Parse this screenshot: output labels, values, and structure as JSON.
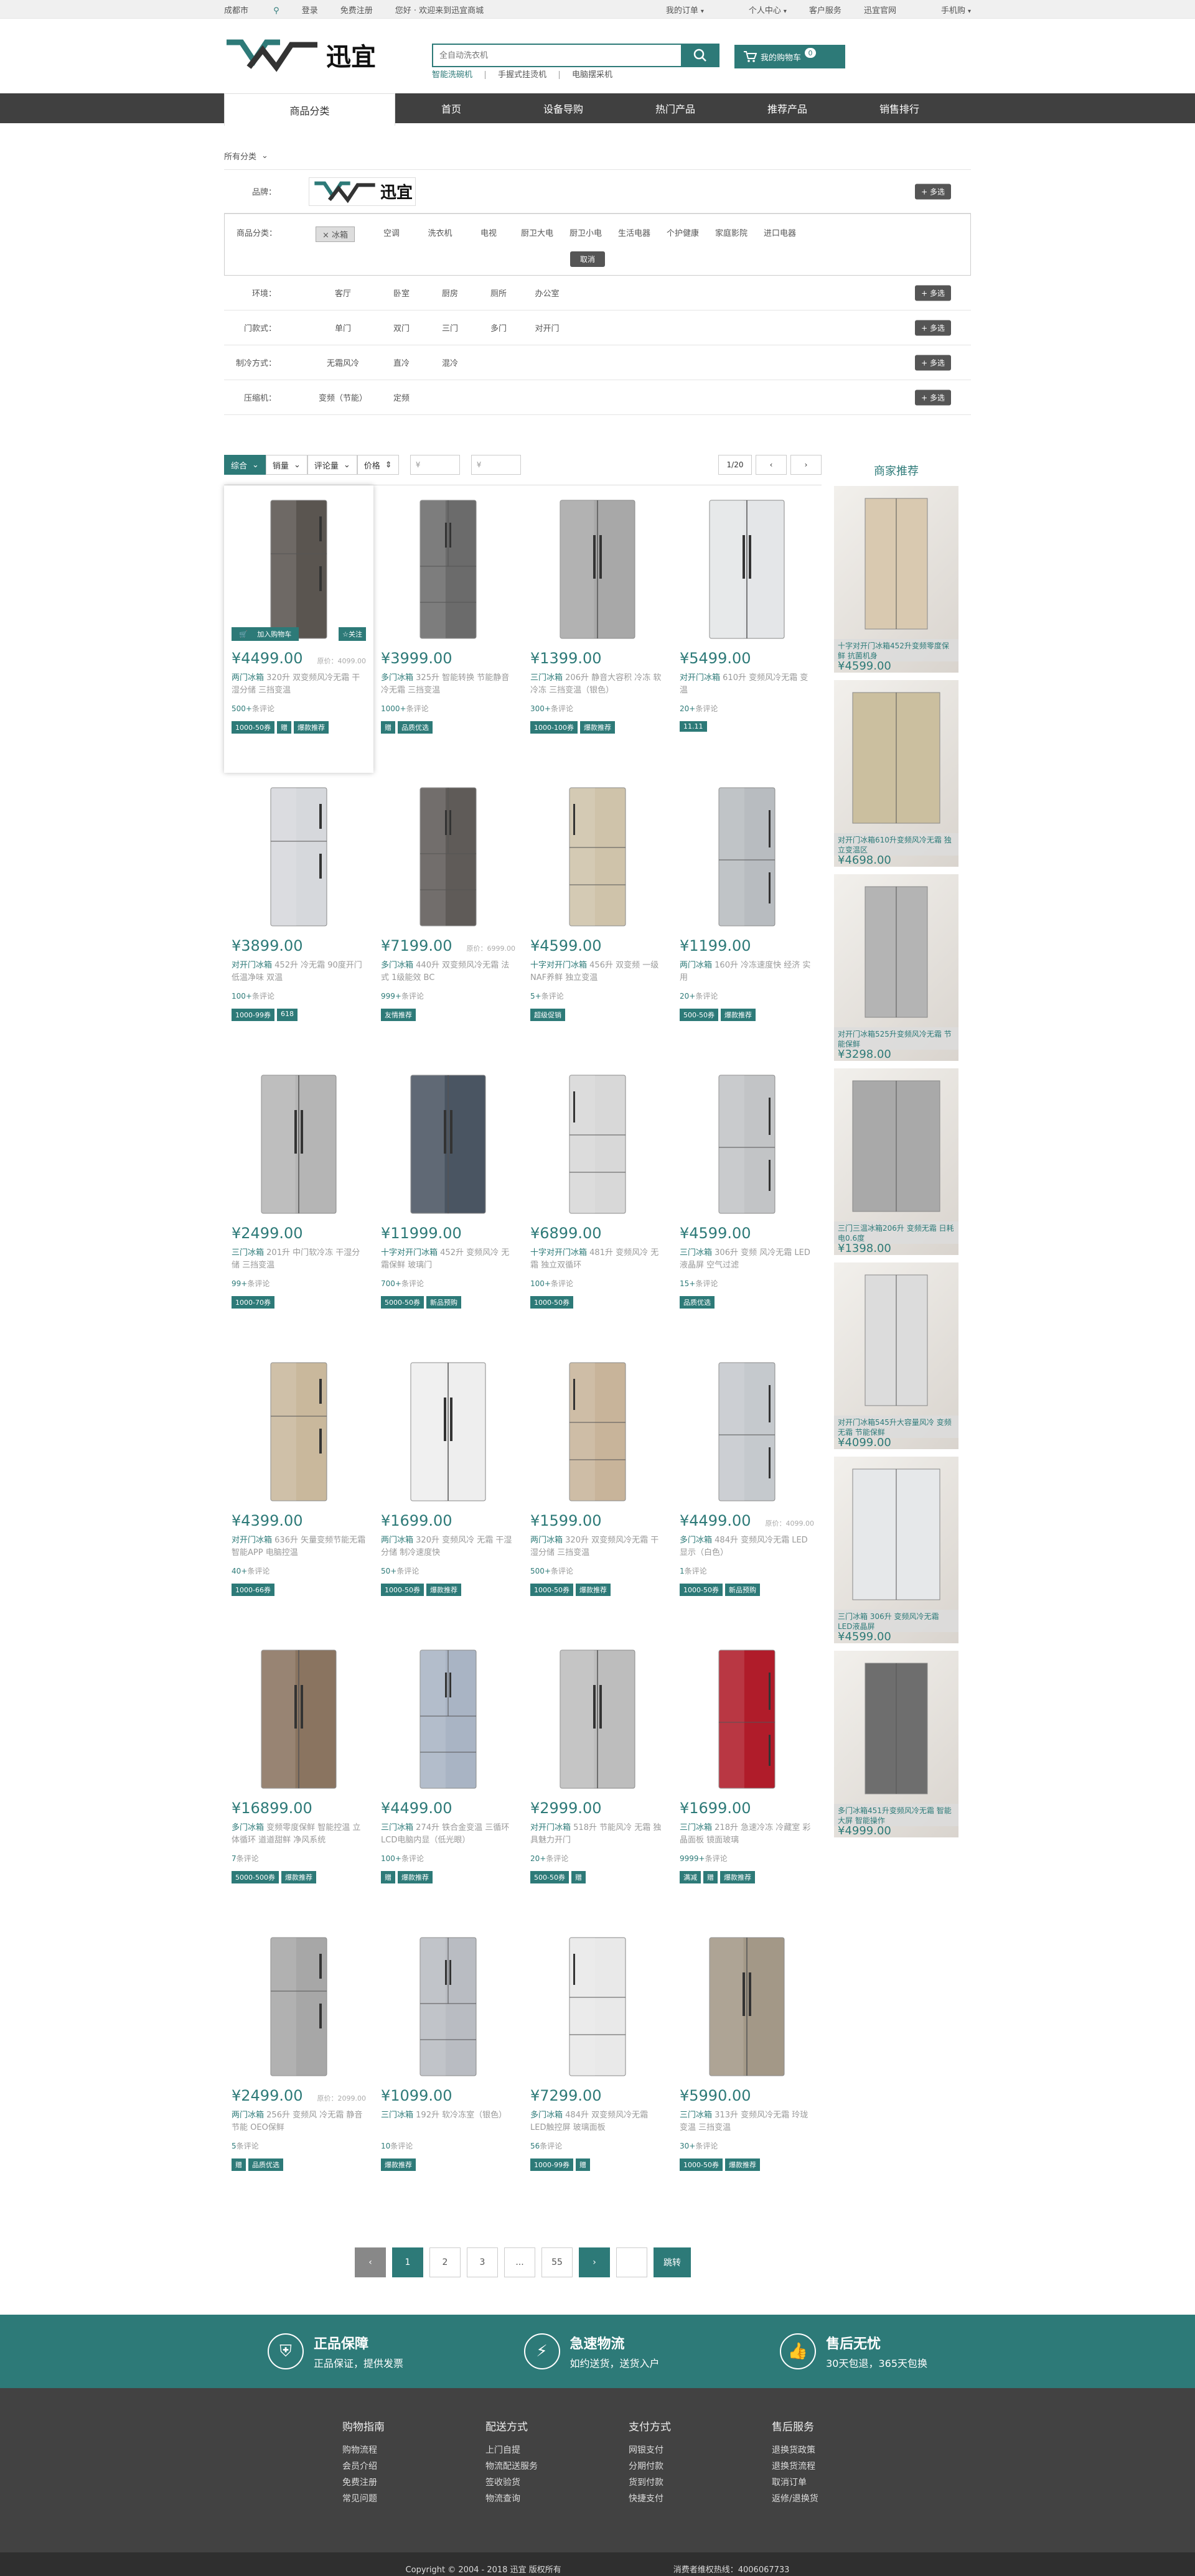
{
  "topbar": {
    "city": "成都市",
    "login": "登录",
    "register": "免费注册",
    "welcome": "您好 · 欢迎来到迅宜商城",
    "my_order": "我的订单",
    "my_center": "个人中心",
    "service": "客户服务",
    "official": "迅宜官网",
    "mobile": "手机购"
  },
  "header": {
    "logo_text": "迅宜",
    "search_placeholder": "全自动洗衣机",
    "hot": [
      "智能洗碗机",
      "手握式挂烫机",
      "电脑摆采机"
    ],
    "cart_label": "我的购物车",
    "cart_count": "0"
  },
  "nav": [
    "商品分类",
    "首页",
    "设备导购",
    "热门产品",
    "推荐产品",
    "销售排行"
  ],
  "crumb": "所有分类",
  "filters": {
    "brand_label": "品牌：",
    "brand_logo": "迅宜",
    "category_label": "商品分类：",
    "categories": [
      "冰箱",
      "空调",
      "洗衣机",
      "电视",
      "厨卫大电",
      "厨卫小电",
      "生活电器",
      "个护健康",
      "家庭影院",
      "进口电器"
    ],
    "cancel": "取消",
    "more": "+ 多选",
    "rows": [
      {
        "label": "环境：",
        "vals": [
          "客厅",
          "卧室",
          "厨房",
          "厕所",
          "办公室"
        ]
      },
      {
        "label": "门款式：",
        "vals": [
          "单门",
          "双门",
          "三门",
          "多门",
          "对开门"
        ]
      },
      {
        "label": "制冷方式：",
        "vals": [
          "无霜风冷",
          "直冷",
          "混冷"
        ]
      },
      {
        "label": "压缩机：",
        "vals": [
          "变频（节能）",
          "定频"
        ]
      }
    ]
  },
  "sortbar": {
    "items": [
      "综合",
      "销量",
      "评论量",
      "价格"
    ],
    "min": "¥",
    "max": "¥",
    "page": "1/20"
  },
  "products": [
    {
      "price": "¥4499.00",
      "old": "原价：4099.00",
      "hl": "两门冰箱",
      "title": " 320升 双变频风冷无霜 干湿分储 三挡变温",
      "rev": "500+",
      "tags": [
        "1000-50券",
        "赠",
        "爆款推荐"
      ],
      "color": "#5a5550",
      "add": "加入购物车",
      "fav": "☆关注"
    },
    {
      "price": "¥3999.00",
      "old": "",
      "hl": "多门冰箱",
      "title": " 325升 智能转换 节能静音 冷无霜 三挡变温",
      "rev": "1000+",
      "tags": [
        "赠",
        "品质优选"
      ],
      "color": "#6b6b6b"
    },
    {
      "price": "¥1399.00",
      "old": "",
      "hl": "三门冰箱",
      "title": " 206升 静音大容积 冷冻 软冷冻 三挡变温（银色）",
      "rev": "300+",
      "tags": [
        "1000-100券",
        "爆款推荐"
      ],
      "color": "#a8a8a8"
    },
    {
      "price": "¥5499.00",
      "old": "",
      "hl": "对开门冰箱",
      "title": " 610升 变频风冷无霜 变温",
      "rev": "20+",
      "tags": [
        "11.11"
      ],
      "color": "#e4e6e8"
    },
    {
      "price": "¥3899.00",
      "old": "",
      "hl": "对开门冰箱",
      "title": " 452升 冷无霜 90度开门 低温净味 双温",
      "rev": "100+",
      "tags": [
        "1000-99券",
        "618"
      ],
      "color": "#d6d8dc"
    },
    {
      "price": "¥7199.00",
      "old": "原价：6999.00",
      "hl": "多门冰箱",
      "title": " 440升 双变频风冷无霜 法式 1级能效 BC",
      "rev": "999+",
      "tags": [
        "友情推荐"
      ],
      "color": "#5f5b58"
    },
    {
      "price": "¥4599.00",
      "old": "",
      "hl": "十字对开门冰箱",
      "title": " 456升 双变频 一级 NAF养鲜 独立变温",
      "rev": "5+",
      "tags": [
        "超级促销"
      ],
      "color": "#cfc3aa"
    },
    {
      "price": "¥1199.00",
      "old": "",
      "hl": "两门冰箱",
      "title": " 160升 冷冻速度快 经济 实用",
      "rev": "20+",
      "tags": [
        "500-50券",
        "爆款推荐"
      ],
      "color": "#b8bcc0"
    },
    {
      "price": "¥2499.00",
      "old": "",
      "hl": "三门冰箱",
      "title": " 201升 中门软冷冻 干湿分储 三挡变温",
      "rev": "99+",
      "tags": [
        "1000-70券"
      ],
      "color": "#b5b5b5"
    },
    {
      "price": "¥11999.00",
      "old": "",
      "hl": "十字对开门冰箱",
      "title": " 452升 变频风冷 无霜保鲜 玻璃门",
      "rev": "700+",
      "tags": [
        "5000-50券",
        "新品预购"
      ],
      "color": "#4a5562"
    },
    {
      "price": "¥6899.00",
      "old": "",
      "hl": "十字对开门冰箱",
      "title": " 481升 变频风冷 无霜 独立双循环",
      "rev": "100+",
      "tags": [
        "1000-50券"
      ],
      "color": "#d8d8d8"
    },
    {
      "price": "¥4599.00",
      "old": "",
      "hl": "三门冰箱",
      "title": " 306升 变频 风冷无霜 LED液晶屏 空气过滤",
      "rev": "15+",
      "tags": [
        "品质优选"
      ],
      "color": "#c2c4c6"
    },
    {
      "price": "¥4399.00",
      "old": "",
      "hl": "对开门冰箱",
      "title": " 636升 矢量变频节能无霜 智能APP 电脑控温",
      "rev": "40+",
      "tags": [
        "1000-66券"
      ],
      "color": "#c9b89c"
    },
    {
      "price": "¥1699.00",
      "old": "",
      "hl": "两门冰箱",
      "title": " 320升 变频风冷 无霜 干湿分储 制冷速度快",
      "rev": "50+",
      "tags": [
        "1000-50券",
        "爆款推荐"
      ],
      "color": "#eeeeee"
    },
    {
      "price": "¥1599.00",
      "old": "",
      "hl": "两门冰箱",
      "title": " 320升 双变频风冷无霜 干湿分储 三挡变温",
      "rev": "500+",
      "tags": [
        "1000-50券",
        "爆款推荐"
      ],
      "color": "#c8b49a"
    },
    {
      "price": "¥4499.00",
      "old": "原价：4099.00",
      "hl": "多门冰箱",
      "title": " 484升 变频风冷无霜 LED显示（白色）",
      "rev": "1",
      "tags": [
        "1000-50券",
        "新品预购"
      ],
      "color": "#c5c9cd"
    },
    {
      "price": "¥16899.00",
      "old": "",
      "hl": "多门冰箱",
      "title": " 变频零度保鲜 智能控温 立体循环 道道甜鲜 净风系统",
      "rev": "7",
      "tags": [
        "5000-500券",
        "爆款推荐"
      ],
      "color": "#8a7460"
    },
    {
      "price": "¥4499.00",
      "old": "",
      "hl": "三门冰箱",
      "title": " 274升 铁合金变温 三循环 LCD电脑内显（低光眼）",
      "rev": "100+",
      "tags": [
        "赠",
        "爆款推荐"
      ],
      "color": "#a9b4c4"
    },
    {
      "price": "¥2999.00",
      "old": "",
      "hl": "对开门冰箱",
      "title": " 518升 节能风冷 无霜 独具魅力开门",
      "rev": "20+",
      "tags": [
        "500-50券",
        "赠"
      ],
      "color": "#bdbdbd"
    },
    {
      "price": "¥1699.00",
      "old": "",
      "hl": "三门冰箱",
      "title": " 218升 急速冷冻 冷藏室 彩晶面板 镜面玻璃",
      "rev": "9999+",
      "tags": [
        "满减",
        "赠",
        "爆款推荐"
      ],
      "color": "#b01c2a"
    },
    {
      "price": "¥2499.00",
      "old": "原价：2099.00",
      "hl": "两门冰箱",
      "title": " 256升 变频风 冷无霜 静音节能 OEO保鲜",
      "rev": "5",
      "tags": [
        "赠",
        "品质优选"
      ],
      "color": "#a7a7a7"
    },
    {
      "price": "¥1099.00",
      "old": "",
      "hl": "三门冰箱",
      "title": " 192升 软冷冻室（银色）",
      "rev": "10",
      "tags": [
        "爆款推荐"
      ],
      "color": "#b9bcc2"
    },
    {
      "price": "¥7299.00",
      "old": "",
      "hl": "多门冰箱",
      "title": " 484升 双变频风冷无霜 LED触控屏 玻璃面板",
      "rev": "56",
      "tags": [
        "1000-99券",
        "赠"
      ],
      "color": "#e9e9e9"
    },
    {
      "price": "¥5990.00",
      "old": "",
      "hl": "三门冰箱",
      "title": " 313升 变频风冷无霜 玲珑变温 三挡变温",
      "rev": "30+",
      "tags": [
        "1000-50券",
        "爆款推荐"
      ],
      "color": "#a39887"
    }
  ],
  "review_suffix": "条评论",
  "side": {
    "title": "商家推荐",
    "items": [
      {
        "cap": "十字对开门冰箱452升变频零度保鲜 抗菌机身",
        "price": "¥4599.00",
        "color": "#d9c9b0"
      },
      {
        "cap": "对开门冰箱610升变频风冷无霜 独立变温区",
        "price": "¥4698.00",
        "color": "#cbbf9f"
      },
      {
        "cap": "对开门冰箱525升变频风冷无霜 节能保鲜",
        "price": "¥3298.00",
        "color": "#b4b4b4"
      },
      {
        "cap": "三门三温冰箱206升 变频无霜 日耗电0.6度",
        "price": "¥1398.00",
        "color": "#a9a9a9"
      },
      {
        "cap": "对开门冰箱545升大容量风冷 变频无霜 节能保鲜",
        "price": "¥4099.00",
        "color": "#dcdcdc"
      },
      {
        "cap": "三门冰箱 306升 变频风冷无霜 LED液晶屏",
        "price": "¥4599.00",
        "color": "#e6e8ea"
      },
      {
        "cap": "多门冰箱451升变频风冷无霜 智能大屏 智能操作",
        "price": "¥4999.00",
        "color": "#6e6e6e"
      }
    ]
  },
  "pager": [
    "‹",
    "1",
    "2",
    "3",
    "...",
    "55",
    "›",
    "",
    "跳转"
  ],
  "services": [
    {
      "title": "正品保障",
      "sub": "正品保证，提供发票",
      "icon": "shield-icon"
    },
    {
      "title": "急速物流",
      "sub": "如约送货，送货入户",
      "icon": "lightning-icon"
    },
    {
      "title": "售后无忧",
      "sub": "30天包退，365天包换",
      "icon": "thumbs-up-icon"
    }
  ],
  "footer": [
    {
      "title": "购物指南",
      "links": [
        "购物流程",
        "会员介绍",
        "免费注册",
        "常见问题"
      ]
    },
    {
      "title": "配送方式",
      "links": [
        "上门自提",
        "物流配送服务",
        "签收验货",
        "物流查询"
      ]
    },
    {
      "title": "支付方式",
      "links": [
        "网银支付",
        "分期付款",
        "货到付款",
        "快捷支付"
      ]
    },
    {
      "title": "售后服务",
      "links": [
        "退换货政策",
        "退换货流程",
        "取消订单",
        "返修/退换货"
      ]
    }
  ],
  "copyright": "Copyright © 2004 - 2018  迅宜 版权所有",
  "hotline": "消费者维权热线：4006067733",
  "colors": {
    "accent": "#2d7a78",
    "nav": "#404040",
    "footer": "#424242"
  }
}
